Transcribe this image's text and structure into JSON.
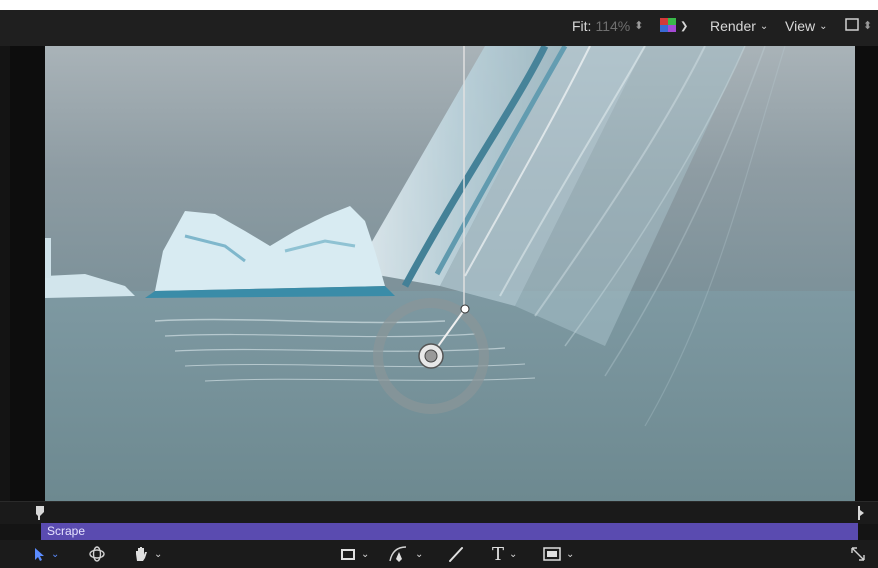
{
  "header": {
    "fit_label": "Fit:",
    "fit_value": "114%",
    "render_label": "Render",
    "view_label": "View"
  },
  "timeline": {
    "clip_label": "Scrape"
  },
  "colors": {
    "clip_bar": "#5a4bb0",
    "accent": "#5b8cff"
  },
  "icons": {
    "color_channels": "color-channels-icon",
    "layout": "layout-icon",
    "select_tool": "arrow-pointer-icon",
    "orbit_tool": "orbit-icon",
    "pan_tool": "hand-icon",
    "shape_tool": "rectangle-icon",
    "pen_tool": "pen-icon",
    "paint_tool": "brush-icon",
    "text_tool": "text-icon",
    "mask_tool": "mask-icon",
    "fullscreen": "expand-icon"
  }
}
